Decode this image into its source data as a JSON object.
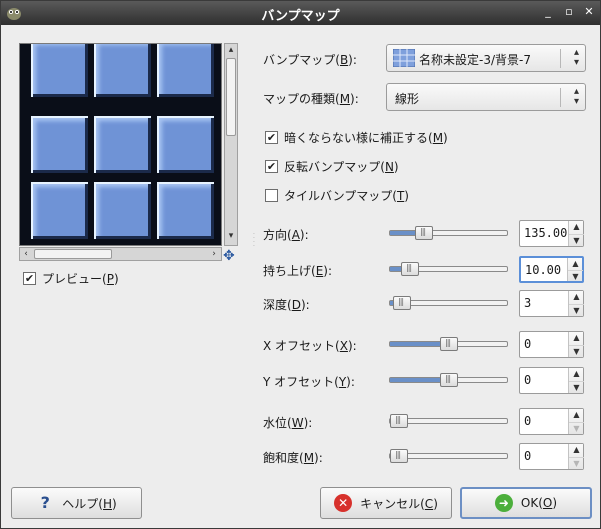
{
  "window": {
    "title": "バンプマップ"
  },
  "preview": {
    "checkbox_label_prefix": "プレビュー(",
    "checkbox_key": "P",
    "checkbox_label_suffix": ")",
    "checked": true
  },
  "bumpmap": {
    "label_prefix": "バンプマップ(",
    "label_key": "B",
    "label_suffix": "):",
    "value": "名称未設定-3/背景-7"
  },
  "maptype": {
    "label_prefix": "マップの種類(",
    "label_key": "M",
    "label_suffix": "):",
    "value": "線形"
  },
  "options": [
    {
      "prefix": "暗くならない様に補正する(",
      "key": "M",
      "suffix": ")",
      "checked": true
    },
    {
      "prefix": "反転バンプマップ(",
      "key": "N",
      "suffix": ")",
      "checked": true
    },
    {
      "prefix": "タイルバンプマップ(",
      "key": "T",
      "suffix": ")",
      "checked": false
    }
  ],
  "params": [
    {
      "prefix": "方向(",
      "key": "A",
      "suffix": "):",
      "value": "135.00",
      "fraction": 0.25
    },
    {
      "prefix": "持ち上げ(",
      "key": "E",
      "suffix": "):",
      "value": "10.00",
      "fraction": 0.11
    },
    {
      "prefix": "深度(",
      "key": "D",
      "suffix": "):",
      "value": "3",
      "fraction": 0.03
    },
    {
      "prefix": "X オフセット(",
      "key": "X",
      "suffix": "):",
      "value": "0",
      "fraction": 0.5
    },
    {
      "prefix": "Y オフセット(",
      "key": "Y",
      "suffix": "):",
      "value": "0",
      "fraction": 0.5
    },
    {
      "prefix": "水位(",
      "key": "W",
      "suffix": "):",
      "value": "0",
      "fraction": 0.0
    },
    {
      "prefix": "飽和度(",
      "key": "M",
      "suffix": "):",
      "value": "0",
      "fraction": 0.0
    }
  ],
  "buttons": {
    "help": {
      "prefix": "ヘルプ(",
      "key": "H",
      "suffix": ")"
    },
    "cancel": {
      "prefix": "キャンセル(",
      "key": "C",
      "suffix": ")"
    },
    "ok": {
      "prefix": "OK(",
      "key": "O",
      "suffix": ")"
    }
  }
}
